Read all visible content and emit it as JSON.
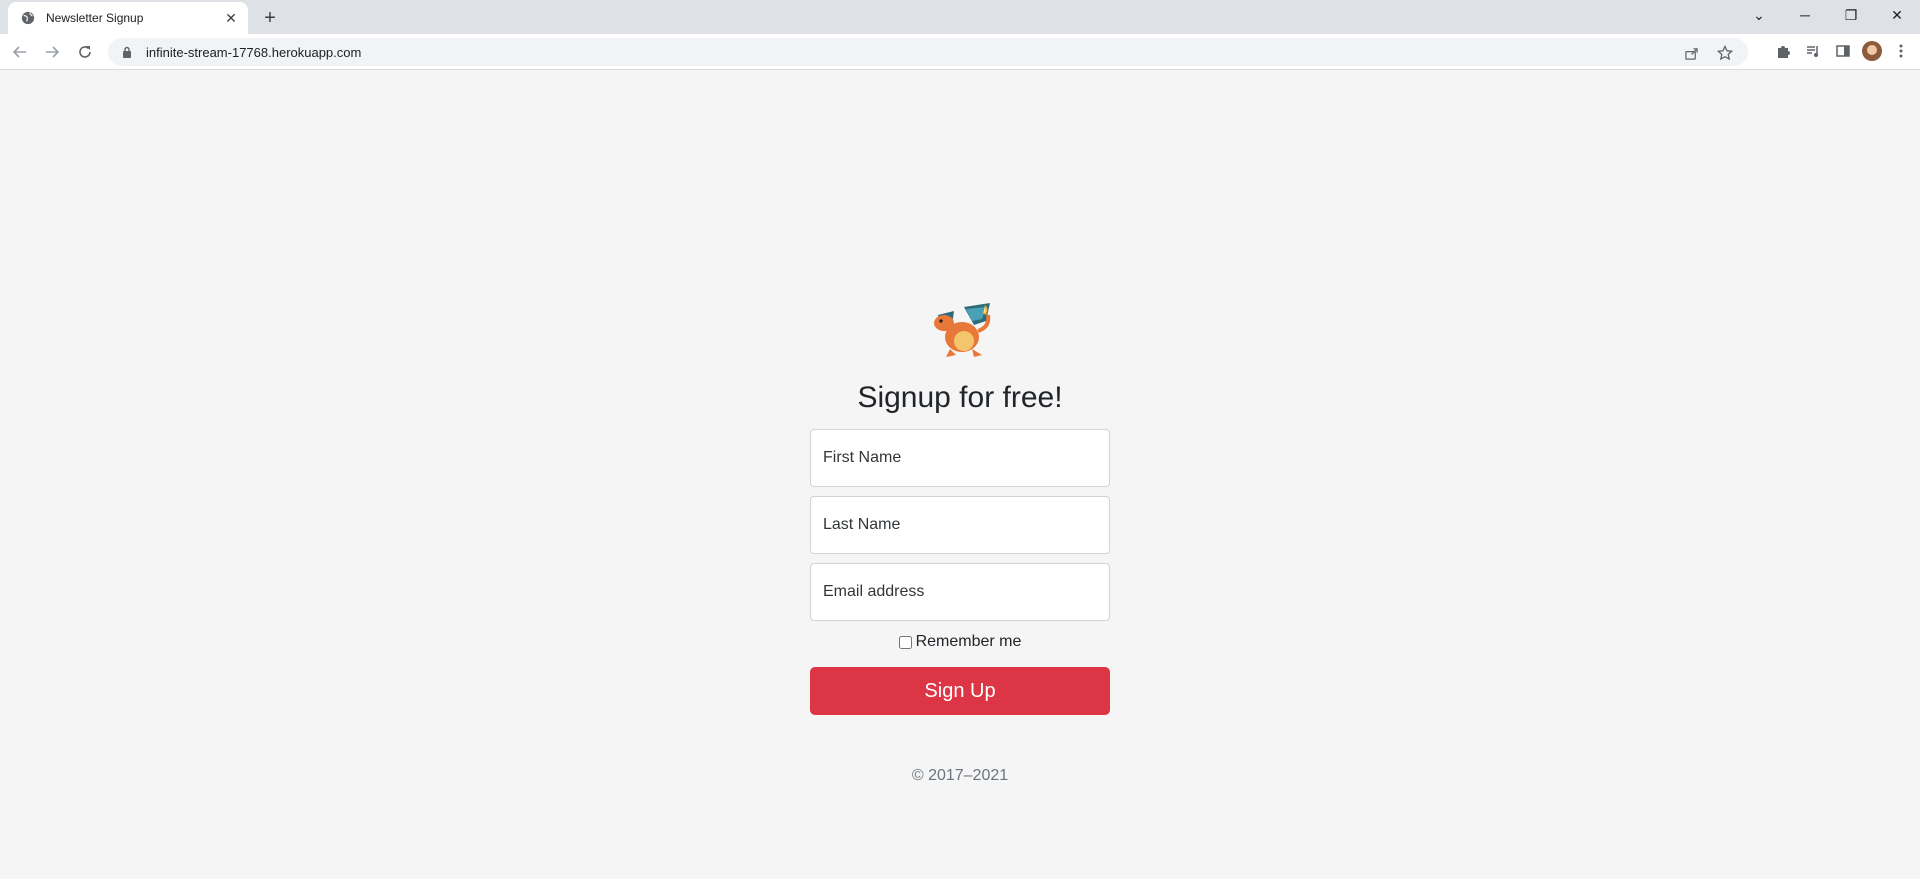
{
  "browser": {
    "tab_title": "Newsletter Signup",
    "tab_close": "✕",
    "new_tab": "+",
    "url": "infinite-stream-17768.herokuapp.com",
    "window_controls": {
      "tabs_menu": "⌄",
      "minimize": "─",
      "restore": "❐",
      "close": "✕"
    }
  },
  "page": {
    "heading": "Signup for free!",
    "first_name_placeholder": "First Name",
    "last_name_placeholder": "Last Name",
    "email_placeholder": "Email address",
    "remember_label": "Remember me",
    "remember_checked": false,
    "submit_label": "Sign Up",
    "footer": "© 2017–2021",
    "colors": {
      "accent": "#dc3545",
      "background": "#f5f5f5"
    }
  }
}
